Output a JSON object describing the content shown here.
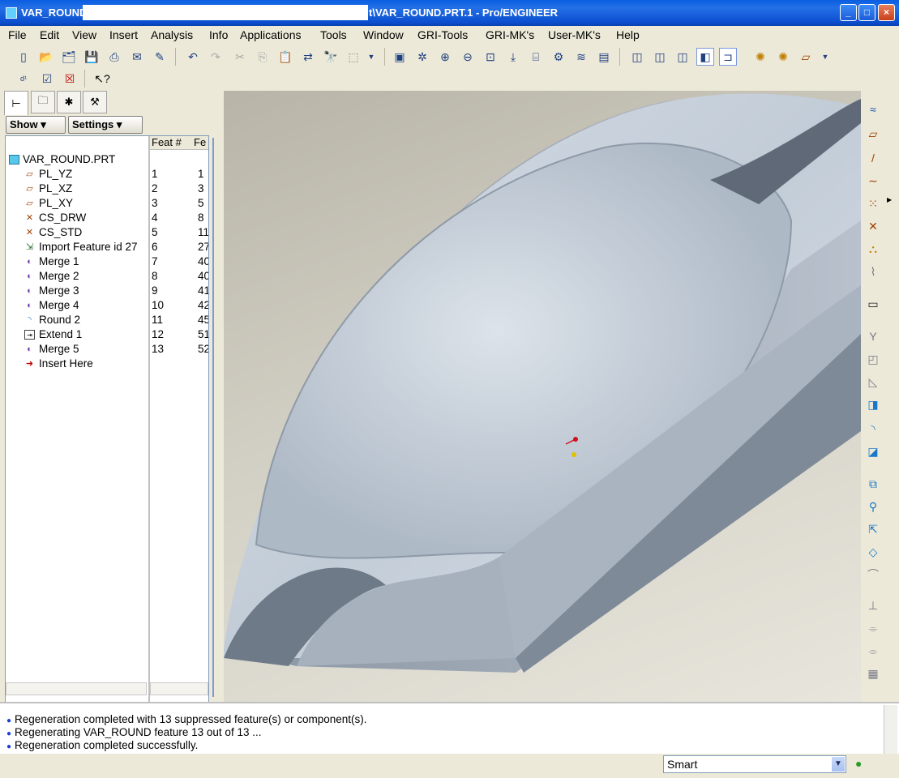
{
  "window": {
    "title_left": "VAR_ROUND",
    "title_right": "t\\VAR_ROUND.PRT.1 - Pro/ENGINEER",
    "min_glyph": "_",
    "max_glyph": "□",
    "close_glyph": "×"
  },
  "menu": [
    "File",
    "Edit",
    "View",
    "Insert",
    "Analysis",
    "Info",
    "Applications",
    "Tools",
    "Window",
    "GRI-Tools",
    "GRI-MK's",
    "User-MK's",
    "Help"
  ],
  "panel": {
    "show_label": "Show ▾",
    "settings_label": "Settings ▾",
    "col_feat": "Feat #",
    "col_fe": "Fe"
  },
  "tree": {
    "root": "VAR_ROUND.PRT",
    "items": [
      {
        "label": "PL_YZ",
        "n1": "1",
        "n2": "1",
        "icon": "datum-plane-icon"
      },
      {
        "label": "PL_XZ",
        "n1": "2",
        "n2": "3",
        "icon": "datum-plane-icon"
      },
      {
        "label": "PL_XY",
        "n1": "3",
        "n2": "5",
        "icon": "datum-plane-icon"
      },
      {
        "label": "CS_DRW",
        "n1": "4",
        "n2": "8",
        "icon": "coordinate-system-icon"
      },
      {
        "label": "CS_STD",
        "n1": "5",
        "n2": "11",
        "icon": "coordinate-system-icon"
      },
      {
        "label": "Import Feature id 27",
        "n1": "6",
        "n2": "27",
        "icon": "import-feature-icon"
      },
      {
        "label": "Merge 1",
        "n1": "7",
        "n2": "40",
        "icon": "merge-icon"
      },
      {
        "label": "Merge 2",
        "n1": "8",
        "n2": "40",
        "icon": "merge-icon"
      },
      {
        "label": "Merge 3",
        "n1": "9",
        "n2": "41",
        "icon": "merge-icon"
      },
      {
        "label": "Merge 4",
        "n1": "10",
        "n2": "42",
        "icon": "merge-icon"
      },
      {
        "label": "Round 2",
        "n1": "11",
        "n2": "45",
        "icon": "round-icon"
      },
      {
        "label": "Extend 1",
        "n1": "12",
        "n2": "51",
        "icon": "extend-icon"
      },
      {
        "label": "Merge 5",
        "n1": "13",
        "n2": "52",
        "icon": "merge-icon"
      }
    ],
    "insert_here": "Insert Here"
  },
  "messages": [
    "Regeneration completed with 13 suppressed feature(s) or component(s).",
    "Regenerating VAR_ROUND feature 13 out of 13 ...",
    "Regeneration completed successfully."
  ],
  "status": {
    "filter_value": "Smart"
  },
  "colors": {
    "titlebar": "#0b4fd0",
    "model_surface": "#c9d2dc",
    "background_top": "#b8b4a8",
    "background_bottom": "#e8e6dc"
  }
}
